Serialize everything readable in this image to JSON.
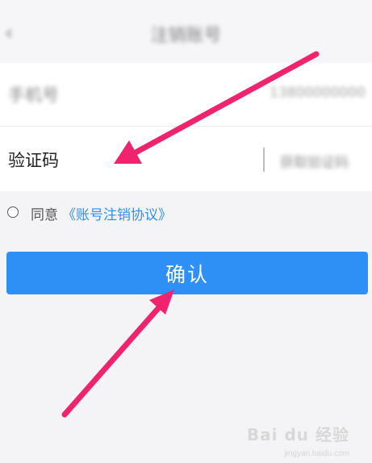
{
  "header": {
    "title": "注销账号",
    "back_icon": "chevron-left-icon"
  },
  "form": {
    "phone_label": "手机号",
    "phone_value": "13800000000",
    "code_label": "验证码",
    "get_code_label": "获取验证码"
  },
  "agreement": {
    "prefix": "同意",
    "link_text": "《账号注销协议》"
  },
  "confirm_label": "确认",
  "watermark": {
    "text": "Bai du 经验",
    "sub": "jingyan.baidu.com"
  },
  "colors": {
    "accent": "#2e8ff5",
    "link": "#2f8ff5",
    "arrow": "#f0246e"
  }
}
